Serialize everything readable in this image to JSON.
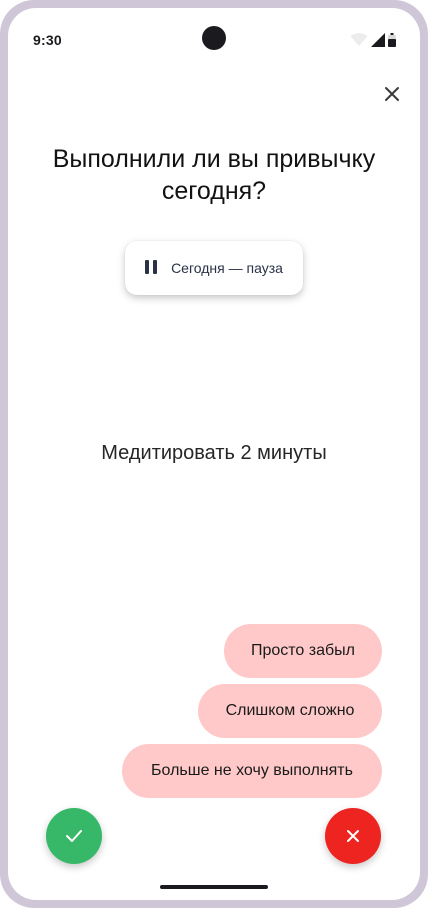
{
  "status_bar": {
    "time": "9:30",
    "icons": [
      "wifi-icon",
      "signal-icon",
      "battery-icon"
    ]
  },
  "header": {
    "close_icon": "close-icon"
  },
  "question": {
    "title": "Выполнили ли вы привычку сегодня?"
  },
  "pause_chip": {
    "icon": "pause-icon",
    "label": "Сегодня — пауза"
  },
  "habit": {
    "name": "Медитировать 2 минуты"
  },
  "reasons": [
    {
      "label": "Просто забыл"
    },
    {
      "label": "Слишком сложно"
    },
    {
      "label": "Больше не хочу выполнять"
    }
  ],
  "actions": {
    "yes_icon": "check-icon",
    "no_icon": "close-icon"
  },
  "colors": {
    "frame": "#cfc7d7",
    "reason_bg": "#ffc9c9",
    "yes": "#37b868",
    "no": "#ee2421",
    "chip_text": "#2a3246"
  }
}
